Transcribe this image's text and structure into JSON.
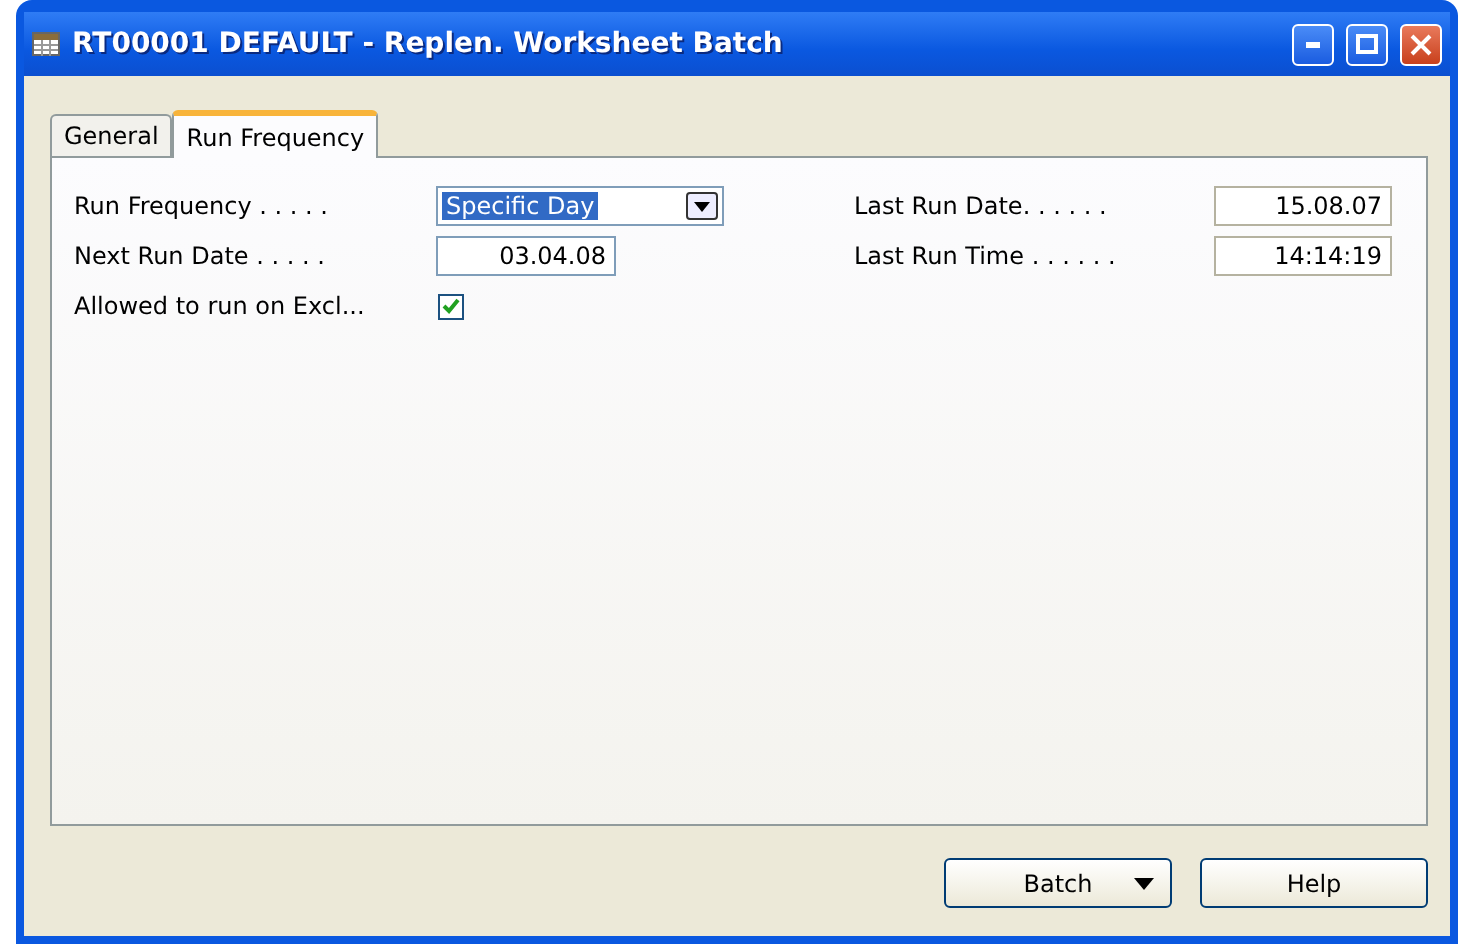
{
  "window": {
    "title": "RT00001 DEFAULT - Replen. Worksheet Batch"
  },
  "tabs": [
    {
      "label": "General",
      "selected": false
    },
    {
      "label": "Run Frequency",
      "selected": true
    }
  ],
  "left_fields": [
    {
      "kind": "dropdown",
      "label": "Run Frequency . . . . .",
      "value": "Specific Day",
      "highlighted": true
    },
    {
      "kind": "text",
      "label": "Next Run Date . . . . .",
      "value": "03.04.08"
    },
    {
      "kind": "checkbox",
      "label": "Allowed to run on Excl...",
      "checked": true
    }
  ],
  "right_fields": [
    {
      "kind": "text",
      "label": "Last Run Date. . . . . .",
      "value": "15.08.07"
    },
    {
      "kind": "text",
      "label": "Last Run Time . . . . . .",
      "value": "14:14:19"
    }
  ],
  "buttons": [
    {
      "label": "Batch",
      "kind": "menu"
    },
    {
      "label": "Help",
      "kind": "plain"
    }
  ]
}
